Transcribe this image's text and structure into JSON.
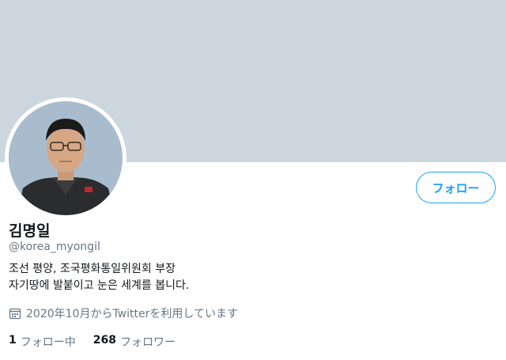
{
  "profile": {
    "display_name": "김명일",
    "handle": "@korea_myongil",
    "bio_line1": "조선 평양, 조국평화통일위원회 부장",
    "bio_line2": "자기땅에 발붙이고 눈은 세계를 봅니다.",
    "joined": "2020年10月からTwitterを利用しています"
  },
  "actions": {
    "follow_label": "フォロー"
  },
  "stats": {
    "following_count": "1",
    "following_label": "フォロー中",
    "followers_count": "268",
    "followers_label": "フォロワー"
  },
  "icons": {
    "calendar": "calendar-icon"
  },
  "colors": {
    "banner": "#ccd6dd",
    "accent": "#1da1f2",
    "secondary_text": "#657786"
  }
}
